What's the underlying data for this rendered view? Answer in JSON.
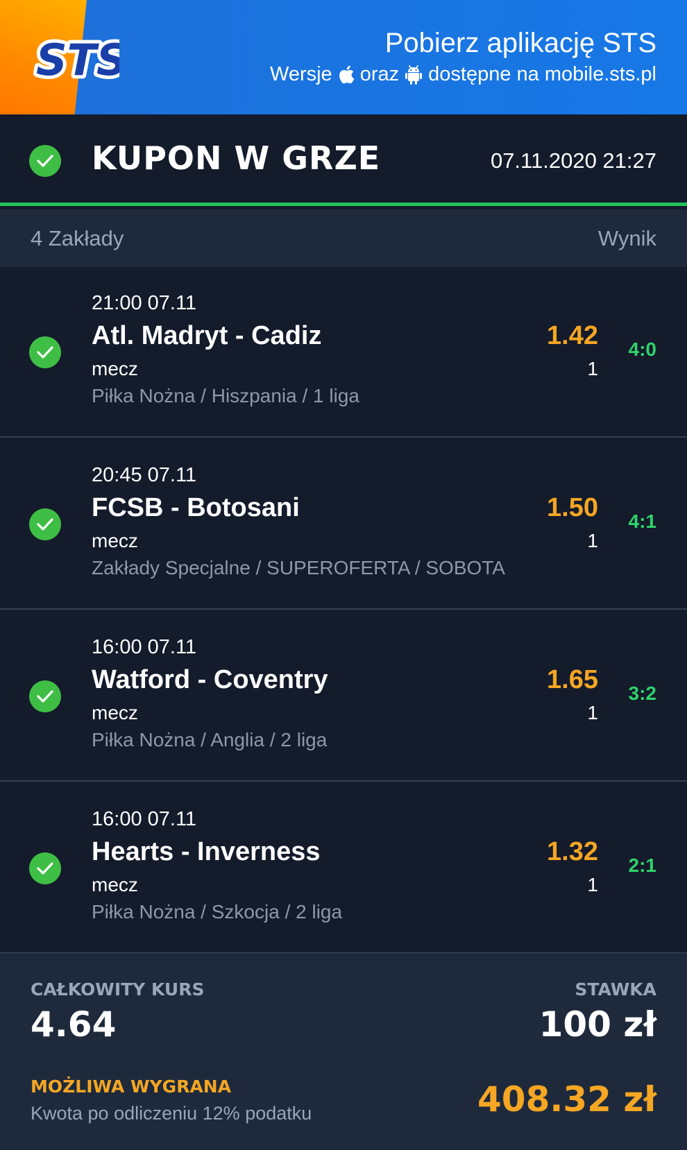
{
  "banner": {
    "logo_text": "STS",
    "title": "Pobierz aplikację STS",
    "sub_prefix": "Wersje",
    "sub_middle": "oraz",
    "sub_suffix": "dostępne na mobile.sts.pl",
    "icons": [
      "apple-icon",
      "android-icon"
    ]
  },
  "header": {
    "title": "KUPON W GRZE",
    "date": "07.11.2020 21:27",
    "status_icon": "check-icon"
  },
  "subheader": {
    "count_label": "4 Zakłady",
    "result_label": "Wynik"
  },
  "bets": [
    {
      "time": "21:00 07.11",
      "match": "Atl. Madryt - Cadiz",
      "type": "mecz",
      "league": "Piłka Nożna / Hiszpania / 1 liga",
      "odds": "1.42",
      "pick": "1",
      "result": "4:0"
    },
    {
      "time": "20:45 07.11",
      "match": "FCSB - Botosani",
      "type": "mecz",
      "league": "Zakłady Specjalne / SUPEROFERTA / SOBOTA",
      "odds": "1.50",
      "pick": "1",
      "result": "4:1"
    },
    {
      "time": "16:00 07.11",
      "match": "Watford - Coventry",
      "type": "mecz",
      "league": "Piłka Nożna / Anglia / 2 liga",
      "odds": "1.65",
      "pick": "1",
      "result": "3:2"
    },
    {
      "time": "16:00 07.11",
      "match": "Hearts - Inverness",
      "type": "mecz",
      "league": "Piłka Nożna / Szkocja / 2 liga",
      "odds": "1.32",
      "pick": "1",
      "result": "2:1"
    }
  ],
  "summary": {
    "total_odds_label": "CAŁKOWITY KURS",
    "total_odds": "4.64",
    "stake_label": "STAWKA",
    "stake": "100 zł",
    "win_label": "MOŻLIWA WYGRANA",
    "win_note": "Kwota po odliczeniu 12% podatku",
    "win_value": "408.32 zł"
  },
  "colors": {
    "accent_orange": "#f5a623",
    "result_green": "#2fd36a",
    "check_green": "#3fbe45",
    "banner_blue": "#1a74e0",
    "background": "#141b2b"
  }
}
